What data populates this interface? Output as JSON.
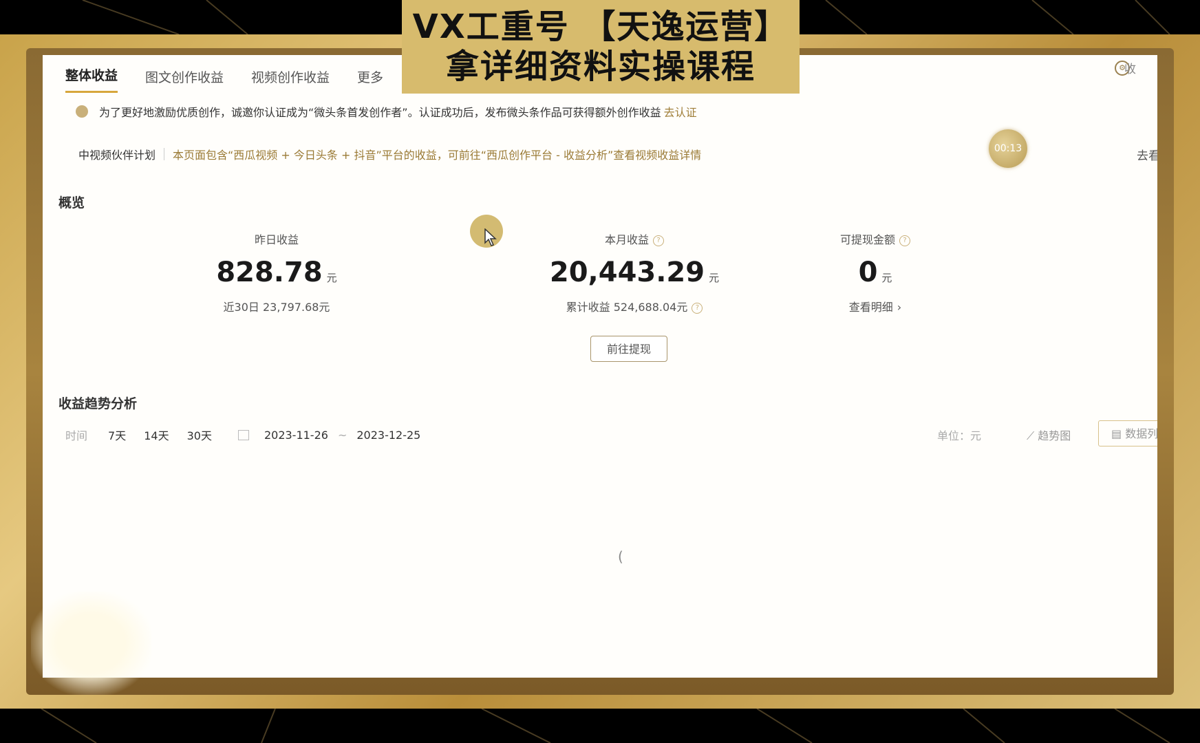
{
  "banner": {
    "line1": "VX工重号 【天逸运营】",
    "line2": "拿详细资料实操课程"
  },
  "tabs": [
    {
      "label": "整体收益",
      "active": true
    },
    {
      "label": "图文创作收益",
      "active": false
    },
    {
      "label": "视频创作收益",
      "active": false
    },
    {
      "label": "更多",
      "active": false
    }
  ],
  "top_right": {
    "text": "收",
    "icon": "settings-icon"
  },
  "notice": {
    "text": "为了更好地激励优质创作，诚邀你认证成为“微头条首发创作者”。认证成功后，发布微头条作品可获得额外创作收益",
    "link": "去认证"
  },
  "partner": {
    "label": "中视频伙伴计划",
    "desc": "本页面包含“西瓜视频 + 今日头条 + 抖音”平台的收益，可前往“西瓜创作平台 - 收益分析”查看视频收益详情",
    "right_text": "去看"
  },
  "timer": "00:13",
  "overview": {
    "title": "概览",
    "stats": [
      {
        "label": "昨日收益",
        "value": "828.78",
        "unit": "元",
        "sub": "近30日 23,797.68元",
        "help": false
      },
      {
        "label": "本月收益",
        "value": "20,443.29",
        "unit": "元",
        "sub": "累计收益 524,688.04元",
        "help": true
      },
      {
        "label": "可提现金额",
        "value": "0",
        "unit": "元",
        "sub": "查看明细",
        "help": true
      }
    ],
    "withdraw_button": "前往提现"
  },
  "trend": {
    "title": "收益趋势分析",
    "time_label": "时间",
    "ranges": [
      "7天",
      "14天",
      "30天"
    ],
    "start_date": "2023-11-26",
    "end_date": "2023-12-25",
    "date_separator": "~",
    "unit_label": "单位：元",
    "trend_button": "趋势图",
    "data_button": "数据列"
  },
  "colors": {
    "accent": "#d7a63c",
    "banner_bg": "#d7bb6d",
    "frame_gold": "#c9a34a"
  }
}
